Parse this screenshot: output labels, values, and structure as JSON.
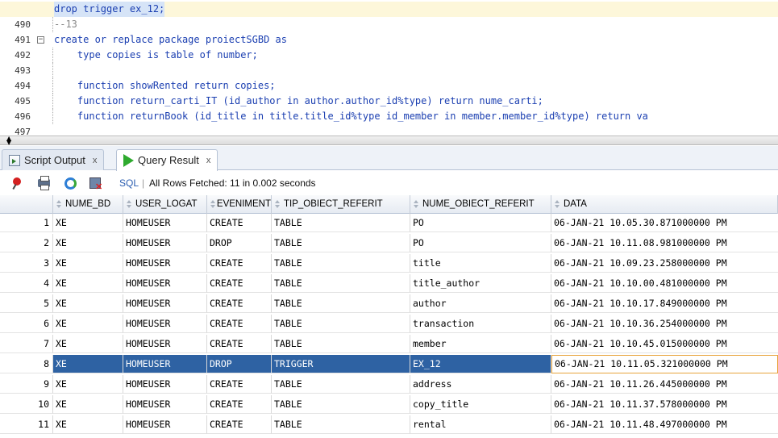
{
  "editor": {
    "lines": [
      {
        "num": "490",
        "text": "drop trigger ex_12;",
        "current": true
      },
      {
        "num": "491",
        "text": "--13",
        "comment": true
      },
      {
        "num": "492",
        "text": "create or replace package proiectSGBD as",
        "fold": "−"
      },
      {
        "num": "493",
        "text": "    type copies is table of number;"
      },
      {
        "num": "494",
        "text": ""
      },
      {
        "num": "495",
        "text": "    function showRented return copies;"
      },
      {
        "num": "496",
        "text": "    function return_carti_IT (id_author in author.author_id%type) return nume_carti;"
      },
      {
        "num": "497",
        "text": "    function returnBook (id_title in title.title_id%type id_member in member.member_id%type) return va"
      }
    ]
  },
  "tabs": [
    {
      "label": "Script Output",
      "close": "x",
      "icon": "script-output-icon"
    },
    {
      "label": "Query Result",
      "close": "x",
      "icon": "run-icon"
    }
  ],
  "toolbar": {
    "sql_label": "SQL",
    "separator": "|",
    "status": "All Rows Fetched: 11 in 0.002 seconds"
  },
  "grid": {
    "columns": [
      "NUME_BD",
      "USER_LOGAT",
      "EVENIMENT",
      "TIP_OBIECT_REFERIT",
      "NUME_OBIECT_REFERIT",
      "DATA"
    ],
    "rows": [
      [
        "1",
        "XE",
        "HOMEUSER",
        "CREATE",
        "TABLE",
        "PO",
        "06-JAN-21 10.05.30.871000000 PM"
      ],
      [
        "2",
        "XE",
        "HOMEUSER",
        "DROP",
        "TABLE",
        "PO",
        "06-JAN-21 10.11.08.981000000 PM"
      ],
      [
        "3",
        "XE",
        "HOMEUSER",
        "CREATE",
        "TABLE",
        "title",
        "06-JAN-21 10.09.23.258000000 PM"
      ],
      [
        "4",
        "XE",
        "HOMEUSER",
        "CREATE",
        "TABLE",
        "title_author",
        "06-JAN-21 10.10.00.481000000 PM"
      ],
      [
        "5",
        "XE",
        "HOMEUSER",
        "CREATE",
        "TABLE",
        "author",
        "06-JAN-21 10.10.17.849000000 PM"
      ],
      [
        "6",
        "XE",
        "HOMEUSER",
        "CREATE",
        "TABLE",
        "transaction",
        "06-JAN-21 10.10.36.254000000 PM"
      ],
      [
        "7",
        "XE",
        "HOMEUSER",
        "CREATE",
        "TABLE",
        "member",
        "06-JAN-21 10.10.45.015000000 PM"
      ],
      [
        "8",
        "XE",
        "HOMEUSER",
        "DROP",
        "TRIGGER",
        "EX_12",
        "06-JAN-21 10.11.05.321000000 PM"
      ],
      [
        "9",
        "XE",
        "HOMEUSER",
        "CREATE",
        "TABLE",
        "address",
        "06-JAN-21 10.11.26.445000000 PM"
      ],
      [
        "10",
        "XE",
        "HOMEUSER",
        "CREATE",
        "TABLE",
        "copy_title",
        "06-JAN-21 10.11.37.578000000 PM"
      ],
      [
        "11",
        "XE",
        "HOMEUSER",
        "CREATE",
        "TABLE",
        "rental",
        "06-JAN-21 10.11.48.497000000 PM"
      ]
    ],
    "selected_row": 8
  }
}
